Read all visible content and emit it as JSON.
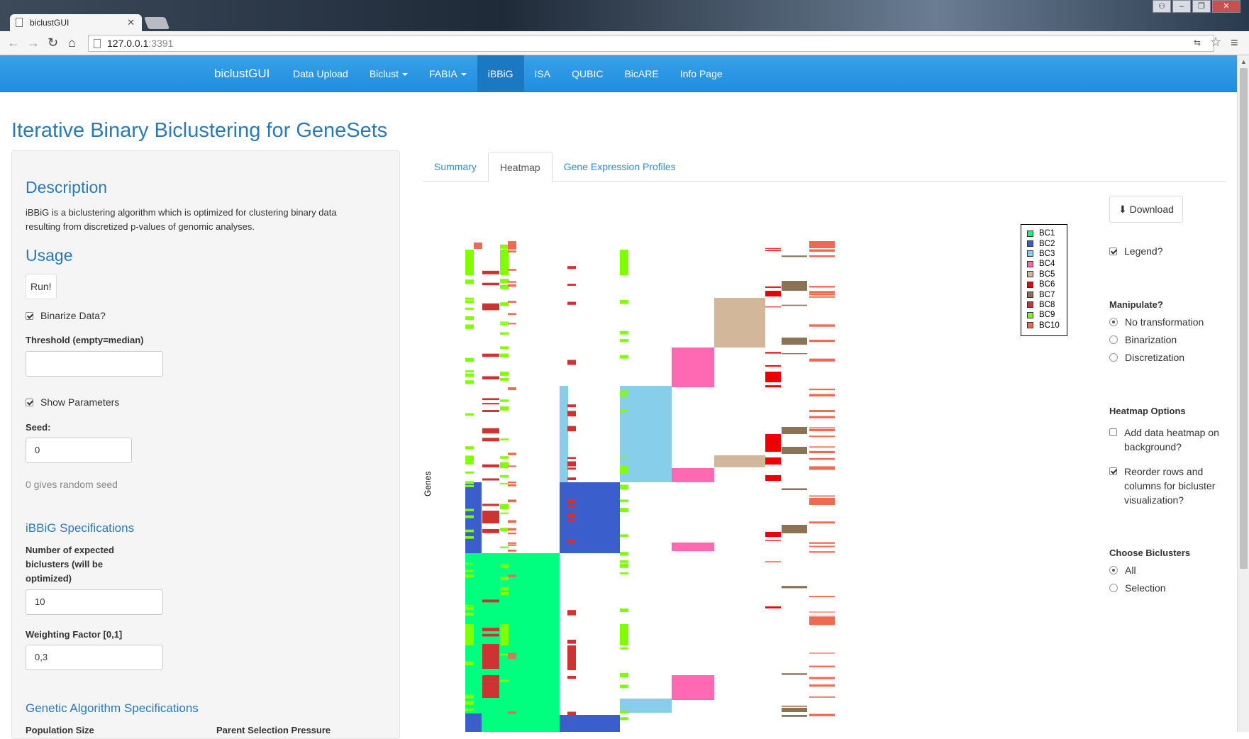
{
  "browser": {
    "tab_title": "biclustGUI",
    "url_host": "127.0.0.1",
    "url_port": ":3391"
  },
  "navbar": {
    "brand": "biclustGUI",
    "items": [
      {
        "label": "Data Upload"
      },
      {
        "label": "Biclust"
      },
      {
        "label": "FABIA"
      },
      {
        "label": "iBBiG"
      },
      {
        "label": "ISA"
      },
      {
        "label": "QUBIC"
      },
      {
        "label": "BicARE"
      },
      {
        "label": "Info Page"
      }
    ]
  },
  "page": {
    "title": "Iterative Binary Biclustering for GeneSets"
  },
  "sidebar": {
    "description_heading": "Description",
    "description_text": "iBBiG is a biclustering algorithm which is optimized for clustering binary data resulting from discretized p-values of genomic analyses.",
    "usage_heading": "Usage",
    "run_button": "Run!",
    "binarize_label": "Binarize Data?",
    "threshold_label": "Threshold (empty=median)",
    "threshold_value": "",
    "show_params_label": "Show Parameters",
    "seed_label": "Seed:",
    "seed_value": "0",
    "seed_help": "0 gives random seed",
    "spec_heading": "iBBiG Specifications",
    "num_biclusters_label": "Number of expected biclusters (will be optimized)",
    "num_biclusters_value": "10",
    "weight_label": "Weighting Factor [0,1]",
    "weight_value": "0,3",
    "genetic_heading": "Genetic Algorithm Specifications",
    "population_label": "Population Size",
    "parent_label": "Parent Selection Pressure"
  },
  "tabs": [
    {
      "label": "Summary"
    },
    {
      "label": "Heatmap"
    },
    {
      "label": "Gene Expression Profiles"
    }
  ],
  "heatmap": {
    "y_label": "Genes",
    "legend": [
      {
        "label": "BC1",
        "color": "#00ff7f"
      },
      {
        "label": "BC2",
        "color": "#3a5fcd"
      },
      {
        "label": "BC3",
        "color": "#87ceeb"
      },
      {
        "label": "BC4",
        "color": "#ff69b4"
      },
      {
        "label": "BC5",
        "color": "#d2b79a"
      },
      {
        "label": "BC6",
        "color": "#ee0000"
      },
      {
        "label": "BC7",
        "color": "#8b7355"
      },
      {
        "label": "BC8",
        "color": "#cd3333"
      },
      {
        "label": "BC9",
        "color": "#7fff00"
      },
      {
        "label": "BC10",
        "color": "#ee6a50"
      }
    ]
  },
  "options": {
    "download_label": "Download",
    "legend_label": "Legend?",
    "manipulate_heading": "Manipulate?",
    "manipulate_options": [
      {
        "label": "No transformation",
        "selected": true
      },
      {
        "label": "Binarization",
        "selected": false
      },
      {
        "label": "Discretization",
        "selected": false
      }
    ],
    "heatmap_options_heading": "Heatmap Options",
    "add_background_label": "Add data heatmap on background?",
    "reorder_label": "Reorder rows and columns for bicluster visualization?",
    "choose_heading": "Choose Biclusters",
    "choose_options": [
      {
        "label": "All",
        "selected": true
      },
      {
        "label": "Selection",
        "selected": false
      }
    ]
  }
}
